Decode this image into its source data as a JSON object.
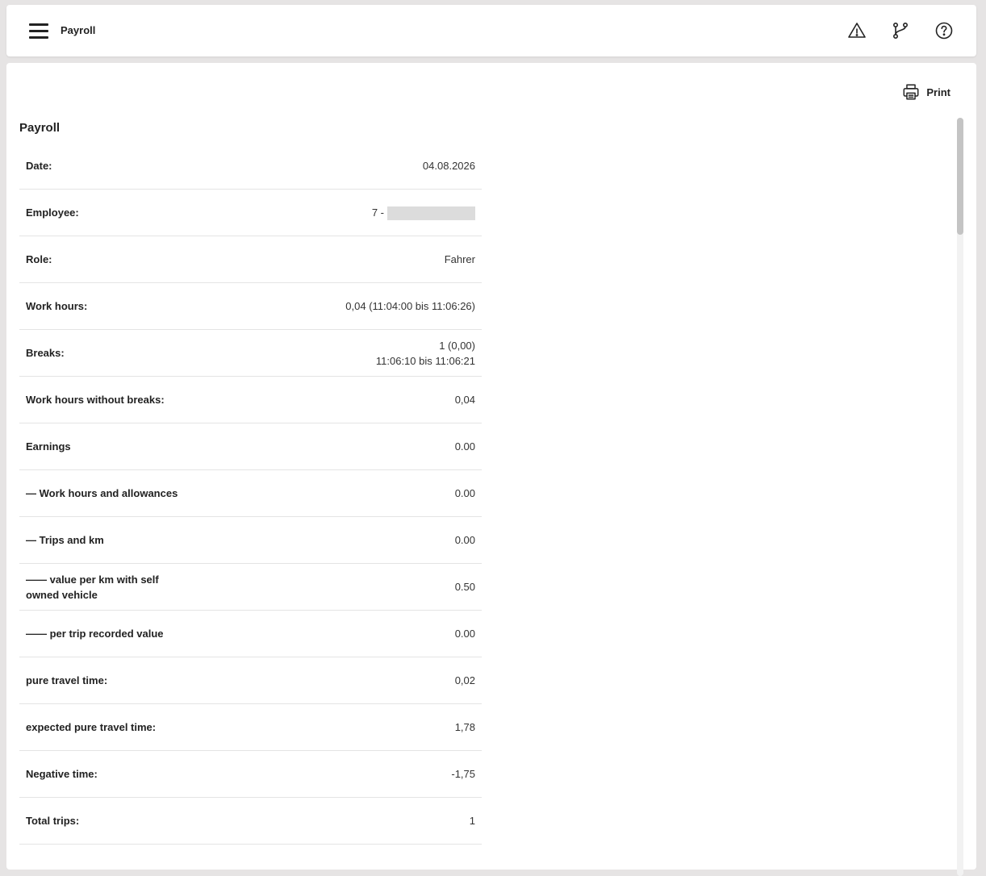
{
  "header": {
    "title": "Payroll",
    "icons": [
      "warning-icon",
      "branch-icon",
      "help-icon"
    ]
  },
  "toolbar": {
    "print_label": "Print"
  },
  "section": {
    "title": "Payroll"
  },
  "rows": [
    {
      "label": "Date:",
      "value": "04.08.2026"
    },
    {
      "label": "Employee:",
      "value": "7 -"
    },
    {
      "label": "Role:",
      "value": "Fahrer"
    },
    {
      "label": "Work hours:",
      "value": "0,04 (11:04:00 bis 11:06:26)"
    },
    {
      "label": "Breaks:",
      "value": "1 (0,00)",
      "value2": "11:06:10 bis 11:06:21"
    },
    {
      "label": "Work hours without breaks:",
      "value": "0,04"
    },
    {
      "label": "Earnings",
      "value": "0.00"
    },
    {
      "label": "— Work hours and allowances",
      "value": "0.00"
    },
    {
      "label": "— Trips and km",
      "value": "0.00"
    },
    {
      "label": "—— value per km with self owned vehicle",
      "value": "0.50"
    },
    {
      "label": "—— per trip recorded value",
      "value": "0.00"
    },
    {
      "label": "pure travel time:",
      "value": "0,02"
    },
    {
      "label": "expected pure travel time:",
      "value": "1,78"
    },
    {
      "label": "Negative time:",
      "value": "-1,75"
    },
    {
      "label": "Total trips:",
      "value": "1"
    }
  ]
}
